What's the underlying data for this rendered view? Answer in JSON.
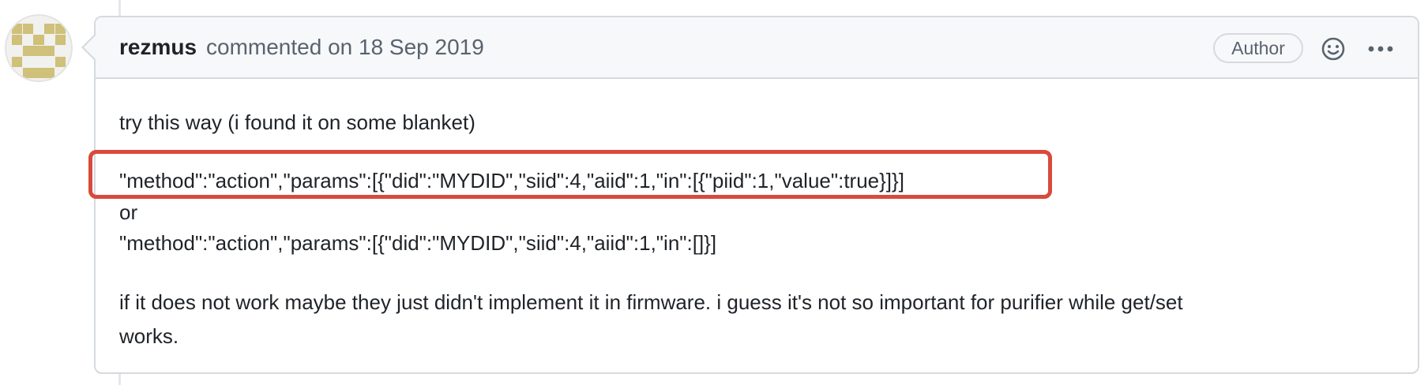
{
  "comment": {
    "author": "rezmus",
    "meta": "commented on 18 Sep 2019",
    "badge": "Author",
    "actions": {
      "reaction_icon": "smiley-icon",
      "more_icon": "kebab-horizontal-icon"
    },
    "body": {
      "line1": "try this way (i found it on some blanket)",
      "code1": "\"method\":\"action\",\"params\":[{\"did\":\"MYDID\",\"siid\":4,\"aiid\":1,\"in\":[{\"piid\":1,\"value\":true}]}]",
      "or": "or",
      "code2": "\"method\":\"action\",\"params\":[{\"did\":\"MYDID\",\"siid\":4,\"aiid\":1,\"in\":[]}]",
      "para_line1": "if it does not work maybe they just didn't implement it in firmware. i guess it's not so important for purifier while get/set",
      "para_line2": "works."
    }
  },
  "colors": {
    "highlight": "#d84a3c",
    "avatar_pattern": "#cfc07a",
    "header_bg": "#f6f8fa",
    "border": "#d6dadf"
  }
}
